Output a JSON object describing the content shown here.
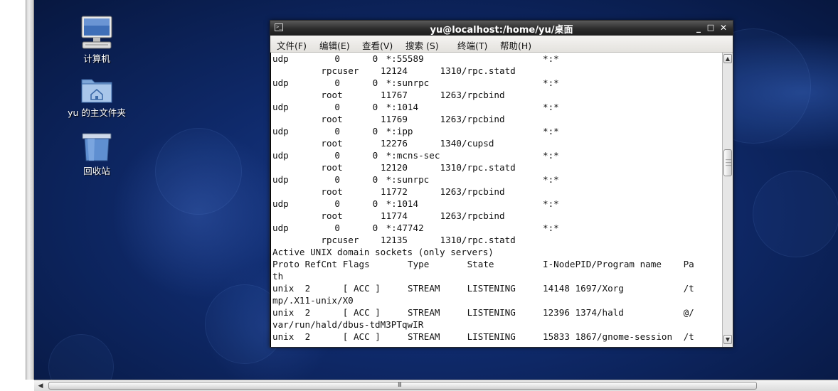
{
  "desktop": {
    "icons": [
      {
        "label": "计算机",
        "icon": "computer-icon"
      },
      {
        "label": "yu 的主文件夹",
        "icon": "home-folder-icon"
      },
      {
        "label": "回收站",
        "icon": "trash-icon"
      }
    ]
  },
  "terminal": {
    "title": "yu@localhost:/home/yu/桌面",
    "controls": {
      "minimize": "_",
      "maximize": "□",
      "close": "✕"
    },
    "menu": [
      "文件(F)",
      "编辑(E)",
      "查看(V)",
      "搜索 (S)",
      "终端(T)",
      "帮助(H)"
    ],
    "lines": [
      {
        "proto": "udp",
        "recvq": "0",
        "sendq": "0",
        "local": "*:55589",
        "foreign": "*:*"
      },
      {
        "user": "rpcuser",
        "inode": "12124",
        "prog": "1310/rpc.statd"
      },
      {
        "proto": "udp",
        "recvq": "0",
        "sendq": "0",
        "local": "*:sunrpc",
        "foreign": "*:*"
      },
      {
        "user": "root",
        "inode": "11767",
        "prog": "1263/rpcbind"
      },
      {
        "proto": "udp",
        "recvq": "0",
        "sendq": "0",
        "local": "*:1014",
        "foreign": "*:*"
      },
      {
        "user": "root",
        "inode": "11769",
        "prog": "1263/rpcbind"
      },
      {
        "proto": "udp",
        "recvq": "0",
        "sendq": "0",
        "local": "*:ipp",
        "foreign": "*:*"
      },
      {
        "user": "root",
        "inode": "12276",
        "prog": "1340/cupsd"
      },
      {
        "proto": "udp",
        "recvq": "0",
        "sendq": "0",
        "local": "*:mcns-sec",
        "foreign": "*:*"
      },
      {
        "user": "root",
        "inode": "12120",
        "prog": "1310/rpc.statd"
      },
      {
        "proto": "udp",
        "recvq": "0",
        "sendq": "0",
        "local": "*:sunrpc",
        "foreign": "*:*"
      },
      {
        "user": "root",
        "inode": "11772",
        "prog": "1263/rpcbind"
      },
      {
        "proto": "udp",
        "recvq": "0",
        "sendq": "0",
        "local": "*:1014",
        "foreign": "*:*"
      },
      {
        "user": "root",
        "inode": "11774",
        "prog": "1263/rpcbind"
      },
      {
        "proto": "udp",
        "recvq": "0",
        "sendq": "0",
        "local": "*:47742",
        "foreign": "*:*"
      },
      {
        "user": "rpcuser",
        "inode": "12135",
        "prog": "1310/rpc.statd"
      },
      {
        "text": "Active UNIX domain sockets (only servers)"
      },
      {
        "hdr": true,
        "proto": "Proto",
        "refcnt": "RefCnt",
        "flags": "Flags",
        "type": "Type",
        "state": "State",
        "inode": "I-Node",
        "prog": "PID/Program name",
        "path": "Pa"
      },
      {
        "text": "th"
      },
      {
        "proto": "unix",
        "refcnt": "2",
        "flags": "[ ACC ]",
        "type": "STREAM",
        "state": "LISTENING",
        "inode": "14148",
        "prog": "1697/Xorg",
        "path": "/t"
      },
      {
        "text": "mp/.X11-unix/X0"
      },
      {
        "proto": "unix",
        "refcnt": "2",
        "flags": "[ ACC ]",
        "type": "STREAM",
        "state": "LISTENING",
        "inode": "12396",
        "prog": "1374/hald",
        "path": "@/"
      },
      {
        "text": "var/run/hald/dbus-tdM3PTqwIR"
      },
      {
        "proto": "unix",
        "refcnt": "2",
        "flags": "[ ACC ]",
        "type": "STREAM",
        "state": "LISTENING",
        "inode": "15833",
        "prog": "1867/gnome-session",
        "path": "/t"
      }
    ]
  },
  "hscroll": {
    "grip": "III"
  }
}
